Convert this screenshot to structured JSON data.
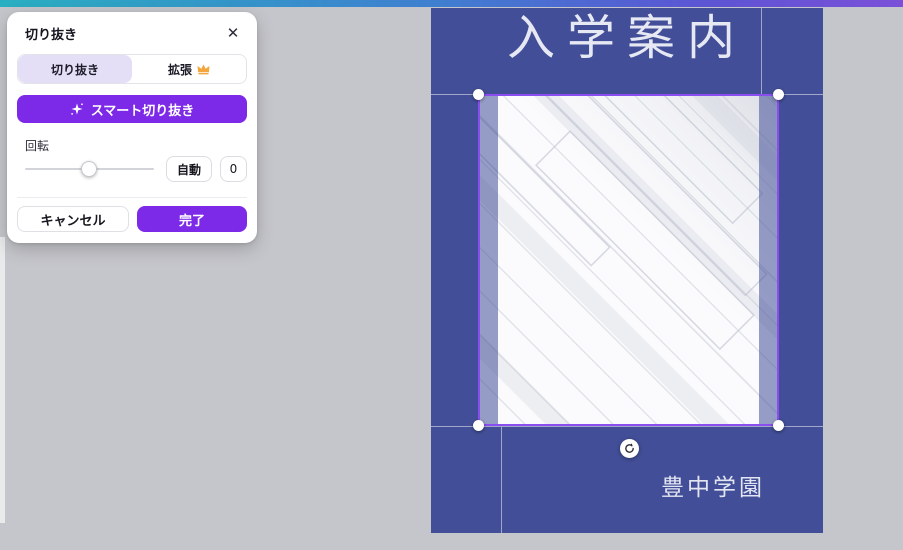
{
  "colors": {
    "accent_purple": "#7d2ae8",
    "tab_selected_bg": "#e5def7",
    "poster_blue": "#424e97",
    "crop_border_purple": "#8a4dee",
    "canvas_background": "#c5c6cb",
    "crown_gold": "#f2a63b",
    "topbar_gradient": [
      "#2aafc2",
      "#3f7fd0",
      "#5c55d4",
      "#7b50d8"
    ]
  },
  "icons": {
    "close": "✕",
    "sparkle": "four-point-sparkle",
    "crown": "premium-crown",
    "rotate": "rotate-arrows"
  },
  "crop_panel": {
    "title": "切り抜き",
    "tabs": [
      {
        "label": "切り抜き",
        "selected": true
      },
      {
        "label": "拡張",
        "selected": false,
        "premium": true
      }
    ],
    "smart_crop_label": "スマート切り抜き",
    "rotation": {
      "label": "回転",
      "slider_percent": 50,
      "auto_label": "自動",
      "value": "0"
    },
    "cancel_label": "キャンセル",
    "done_label": "完了"
  },
  "canvas": {
    "poster_title": "入学案内",
    "poster_footer": "豊中学園"
  }
}
